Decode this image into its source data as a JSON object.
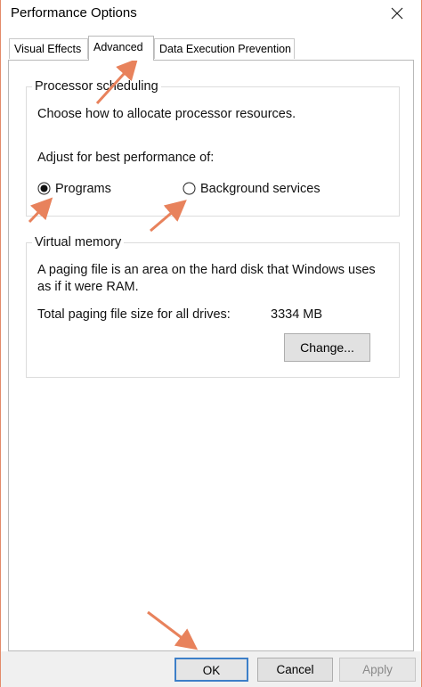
{
  "window": {
    "title": "Performance Options"
  },
  "tabs": [
    {
      "label": "Visual Effects",
      "active": false
    },
    {
      "label": "Advanced",
      "active": true
    },
    {
      "label": "Data Execution Prevention",
      "active": false
    }
  ],
  "processor_scheduling": {
    "legend": "Processor scheduling",
    "description": "Choose how to allocate processor resources.",
    "adjust_label": "Adjust for best performance of:",
    "options": [
      {
        "label": "Programs",
        "selected": true
      },
      {
        "label": "Background services",
        "selected": false
      }
    ]
  },
  "virtual_memory": {
    "legend": "Virtual memory",
    "description_line1": "A paging file is an area on the hard disk that Windows uses",
    "description_line2": "as if it were RAM.",
    "total_label": "Total paging file size for all drives:",
    "total_value": "3334 MB",
    "change_button": "Change..."
  },
  "footer": {
    "ok": "OK",
    "cancel": "Cancel",
    "apply": "Apply",
    "apply_enabled": false
  },
  "colors": {
    "annotation_arrow": "#e8825c",
    "ok_border": "#3d7fc8"
  },
  "icons": {
    "close": "close-icon",
    "annotation": "annotation-arrow-icon"
  }
}
